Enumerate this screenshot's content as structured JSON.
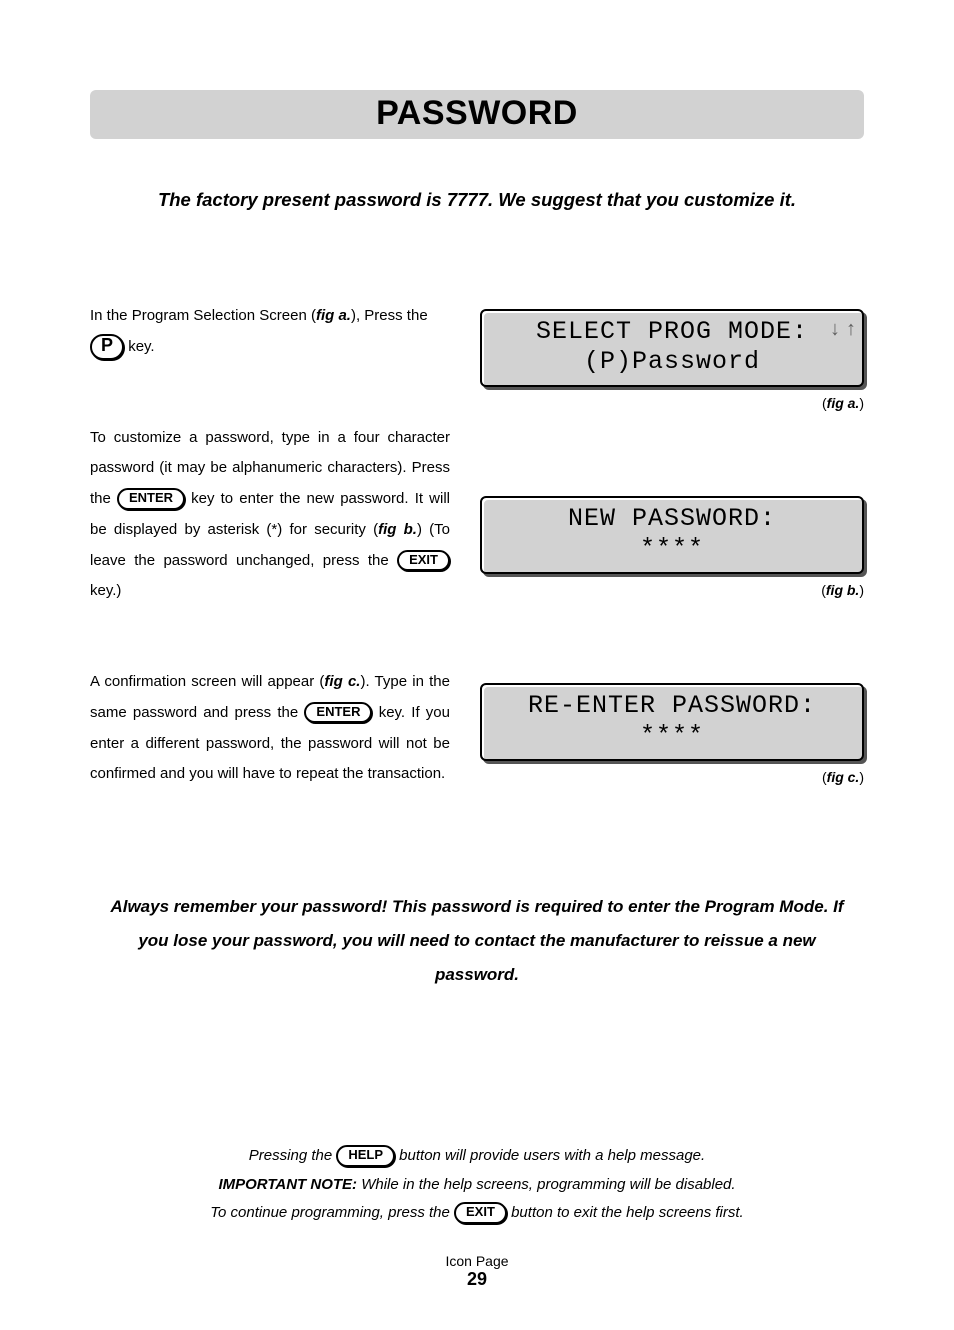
{
  "title": "PASSWORD",
  "intro": "The factory present password is 7777. We suggest that you customize it.",
  "keys": {
    "p": "P",
    "enter": "ENTER",
    "exit": "EXIT",
    "help": "HELP"
  },
  "step1": {
    "t1": "In the Program Selection Screen (",
    "fig": "fig a.",
    "t2": "), Press the ",
    "t3": " key."
  },
  "step2": {
    "t1": "To customize a password, type in a four character password (it may be alphanumeric characters). Press the ",
    "t2": " key to enter the new password. It will be displayed by asterisk (*) for security (",
    "fig": "fig b.",
    "t3": ") (To leave the password unchanged, press the ",
    "t4": " key.)"
  },
  "step3": {
    "t1": "A confirmation screen will appear (",
    "fig": "fig c.",
    "t2": "). Type in the same password and press the ",
    "t3": " key. If you enter a different password, the password will not be confirmed and you will have to repeat the transaction."
  },
  "lcd_a": {
    "l1": "SELECT PROG MODE:",
    "l2": "(P)Password",
    "label": "fig a."
  },
  "lcd_b": {
    "l1": "NEW PASSWORD:",
    "l2": "****",
    "label": "fig b."
  },
  "lcd_c": {
    "l1": "RE-ENTER PASSWORD:",
    "l2": "****",
    "label": "fig c."
  },
  "warning": "Always remember your password! This password is required to enter the Program Mode.  If you lose your password, you will need to contact the manufacturer to reissue a new password.",
  "footer": {
    "l1a": "Pressing the ",
    "l1b": " button will provide users with a help message.",
    "l2a": "IMPORTANT NOTE:",
    "l2b": " While in the help screens, programming will be disabled.",
    "l3a": "To continue programming, press the ",
    "l3b": " button to exit the help screens first."
  },
  "pagefoot": {
    "label": "Icon Page",
    "num": "29"
  }
}
